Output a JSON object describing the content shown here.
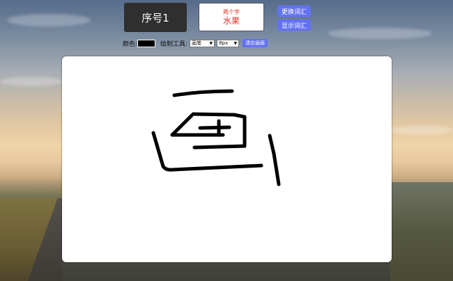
{
  "header": {
    "sequence_label": "序号1",
    "word_hint": "两个字",
    "word_answer": "水果"
  },
  "buttons": {
    "change_word": "更换词汇",
    "show_word": "显示词汇",
    "clear_canvas": "清空画板"
  },
  "toolbar": {
    "color_label": "颜色:",
    "color_value": "#000000",
    "tool_label": "绘制工具:",
    "tool_selected": "画笔",
    "size_selected": "8px"
  }
}
